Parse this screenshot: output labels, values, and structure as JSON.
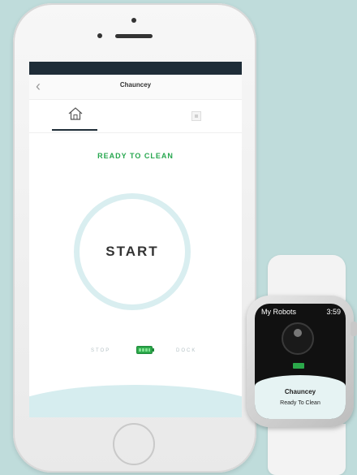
{
  "phone": {
    "nav": {
      "back_icon": "chevron-left-icon",
      "title": "Chauncey"
    },
    "tabs": [
      {
        "icon": "home-icon",
        "active": true
      },
      {
        "icon": "map-icon",
        "active": false
      }
    ],
    "status": "READY TO CLEAN",
    "start_label": "START",
    "stop_label": "STOP",
    "dock_label": "DOCK",
    "battery_icon": "battery-icon"
  },
  "watch": {
    "header_title": "My Robots",
    "time": "3:59",
    "robot_name": "Chauncey",
    "robot_status": "Ready To Clean"
  },
  "colors": {
    "background": "#bfdcdb",
    "accent_green": "#27a74f",
    "ring": "#d9eef0",
    "status_bar": "#1f2d38"
  }
}
